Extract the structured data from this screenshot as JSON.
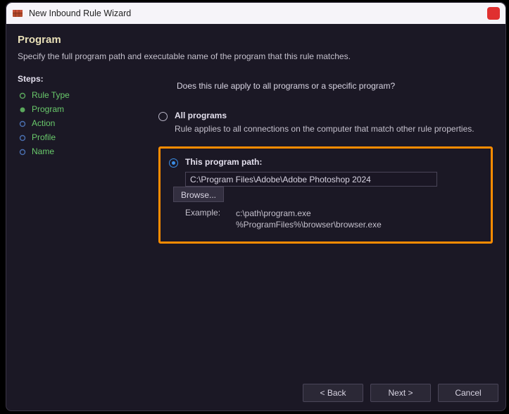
{
  "window": {
    "title": "New Inbound Rule Wizard"
  },
  "header": {
    "title": "Program",
    "description": "Specify the full program path and executable name of the program that this rule matches."
  },
  "sidebar": {
    "steps_label": "Steps:",
    "steps": [
      {
        "label": "Rule Type",
        "state": "done"
      },
      {
        "label": "Program",
        "state": "active"
      },
      {
        "label": "Action",
        "state": "pending"
      },
      {
        "label": "Profile",
        "state": "pending"
      },
      {
        "label": "Name",
        "state": "pending"
      }
    ]
  },
  "main": {
    "question": "Does this rule apply to all programs or a specific program?",
    "option_all": {
      "label": "All programs",
      "desc": "Rule applies to all connections on the computer that match other rule properties.",
      "checked": false
    },
    "option_path": {
      "label": "This program path:",
      "checked": true,
      "value": "C:\\Program Files\\Adobe\\Adobe Photoshop 2024",
      "browse_label": "Browse...",
      "example_label": "Example:",
      "example_line1": "c:\\path\\program.exe",
      "example_line2": "%ProgramFiles%\\browser\\browser.exe"
    }
  },
  "footer": {
    "back": "< Back",
    "next": "Next >",
    "cancel": "Cancel"
  }
}
